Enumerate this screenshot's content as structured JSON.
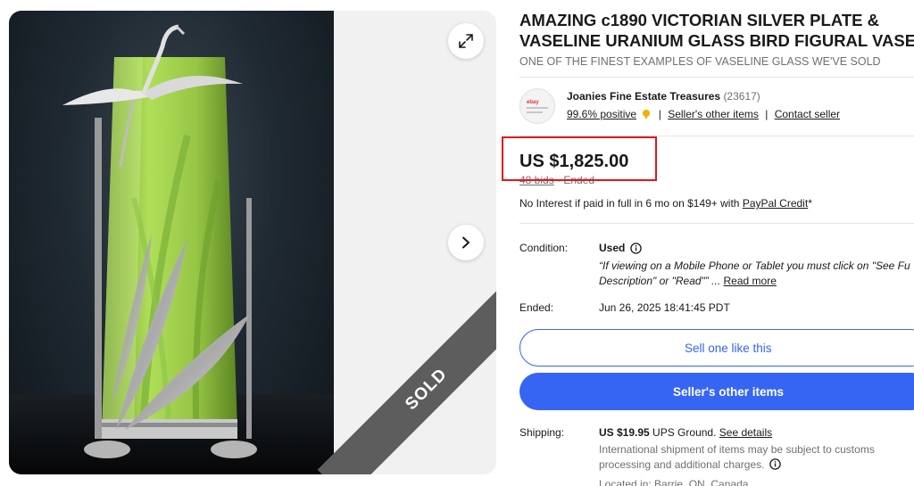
{
  "listing": {
    "title": "AMAZING c1890 VICTORIAN SILVER PLATE & VASELINE URANIUM GLASS BIRD FIGURAL VASE",
    "subtitle": "ONE OF THE FINEST EXAMPLES OF VASELINE GLASS WE'VE SOLD"
  },
  "gallery": {
    "badge": "SOLD",
    "icons": {
      "expand": "expand-icon",
      "next": "chevron-right-icon"
    }
  },
  "seller": {
    "name": "Joanies Fine Estate Treasures",
    "feedback_count": "(23617)",
    "positive": "99.6% positive",
    "other_items_link": "Seller's other items",
    "contact_link": "Contact seller",
    "logo_text": "ebay"
  },
  "price": {
    "amount": "US $1,825.00",
    "bids": "48 bids",
    "status": "· Ended",
    "financing_text": "No Interest if paid in full in 6 mo on $149+ with ",
    "financing_link": "PayPal Credit",
    "financing_suffix": "*"
  },
  "details": {
    "condition_label": "Condition:",
    "condition_value": "Used",
    "condition_desc_line1": "“If viewing on a Mobile Phone or Tablet you must click on \"See Fu",
    "condition_desc_line2": "Description\" or \"Read\"” ...",
    "read_more": "Read more",
    "ended_label": "Ended:",
    "ended_value": "Jun 26, 2025 18:41:45 PDT"
  },
  "actions": {
    "sell_one": "Sell one like this",
    "sellers_other": "Seller's other items"
  },
  "shipping": {
    "label": "Shipping:",
    "cost": "US $19.95",
    "method": " UPS Ground. ",
    "details_link": "See details",
    "note": "International shipment of items may be subject to customs processing and additional charges.",
    "location": "Located in: Barrie, ON, Canada"
  },
  "colors": {
    "accent": "#3665f3",
    "highlight_box": "#e4151f",
    "sold_ribbon": "#5d5d5d"
  }
}
